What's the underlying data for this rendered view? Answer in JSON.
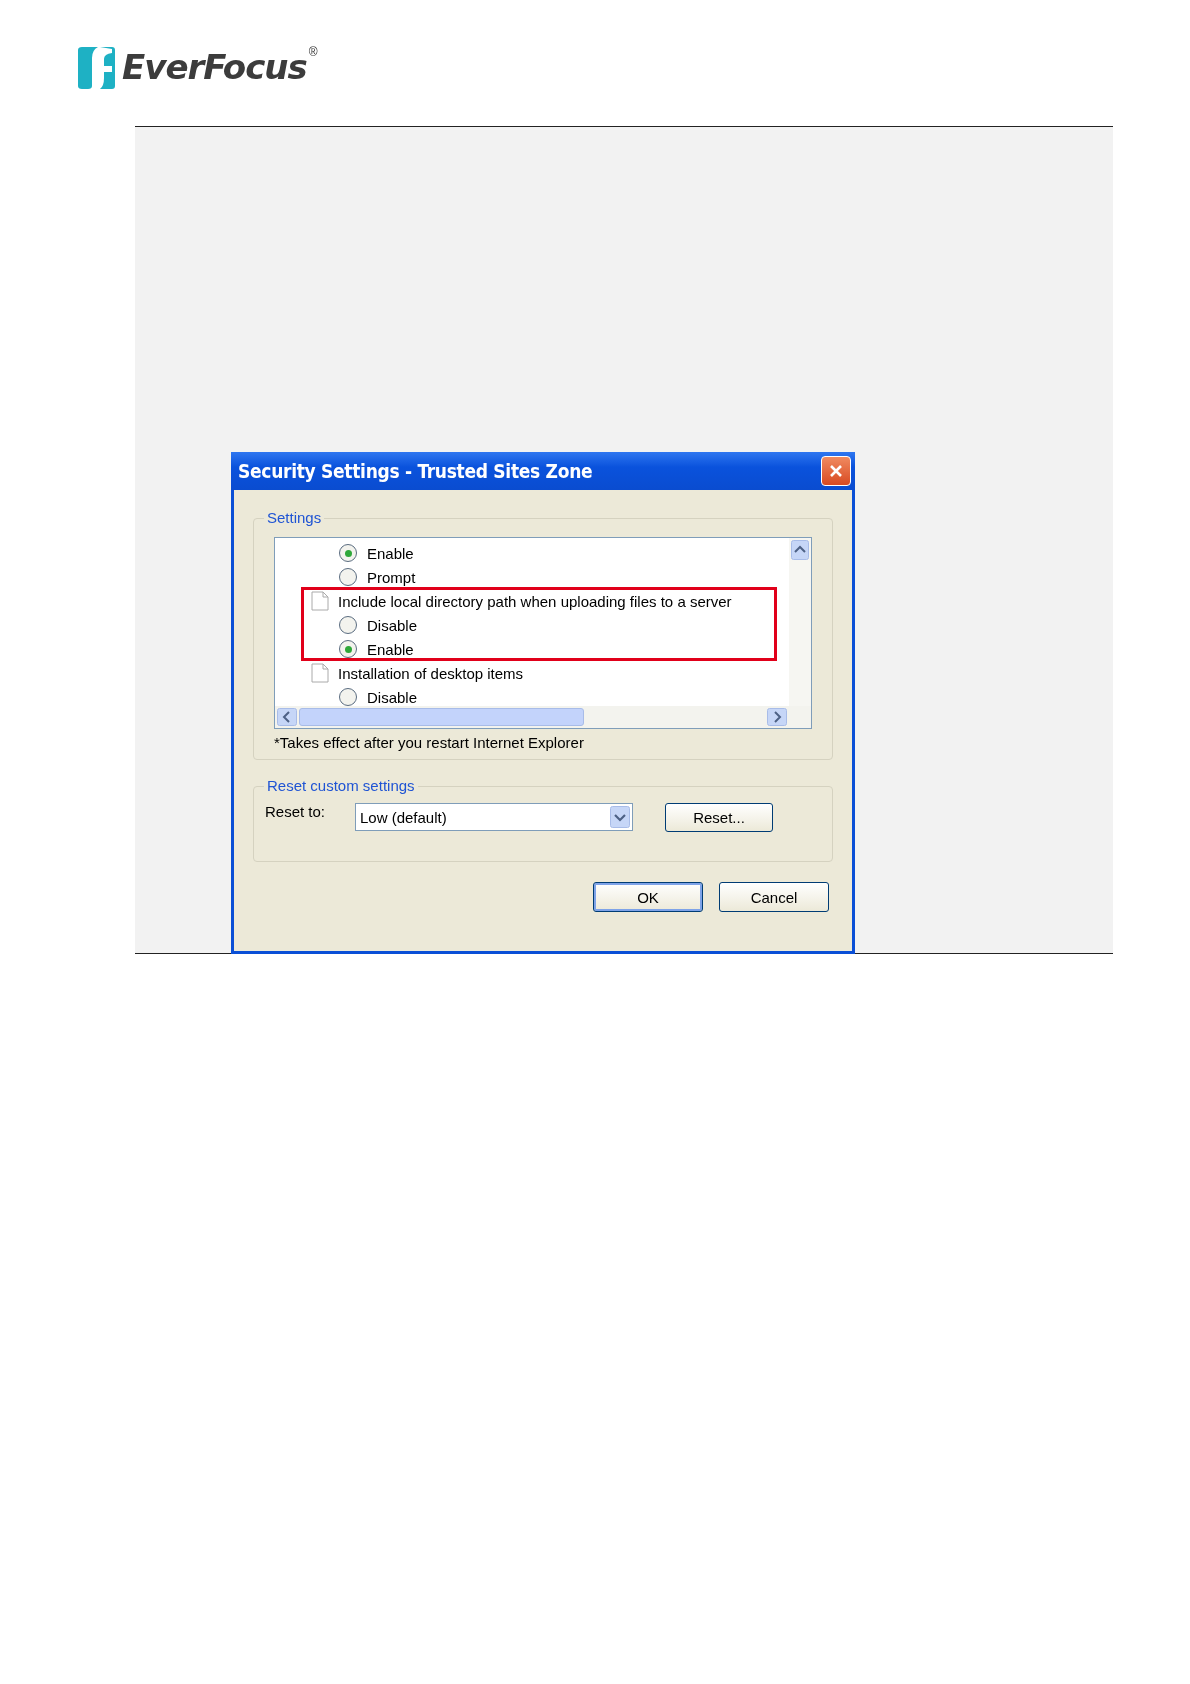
{
  "logo": {
    "name": "EverFocus",
    "mark": "®"
  },
  "dialog": {
    "title": "Security Settings - Trusted Sites Zone",
    "settings": {
      "label": "Settings",
      "items": [
        {
          "kind": "radio",
          "label": "Enable",
          "selected": true
        },
        {
          "kind": "radio",
          "label": "Prompt",
          "selected": false
        },
        {
          "kind": "heading",
          "label": "Include local directory path when uploading files to a server",
          "highlighted": true,
          "children": [
            {
              "label": "Disable",
              "selected": false
            },
            {
              "label": "Enable",
              "selected": true
            }
          ]
        },
        {
          "kind": "heading",
          "label": "Installation of desktop items",
          "highlighted": false,
          "children": [
            {
              "label": "Disable",
              "selected": false
            }
          ]
        }
      ],
      "note": "*Takes effect after you restart Internet Explorer"
    },
    "reset": {
      "label": "Reset custom settings",
      "field_label": "Reset to:",
      "value": "Low (default)",
      "button": "Reset..."
    },
    "buttons": [
      {
        "label": "OK",
        "default": true
      },
      {
        "label": "Cancel",
        "default": false
      }
    ]
  }
}
